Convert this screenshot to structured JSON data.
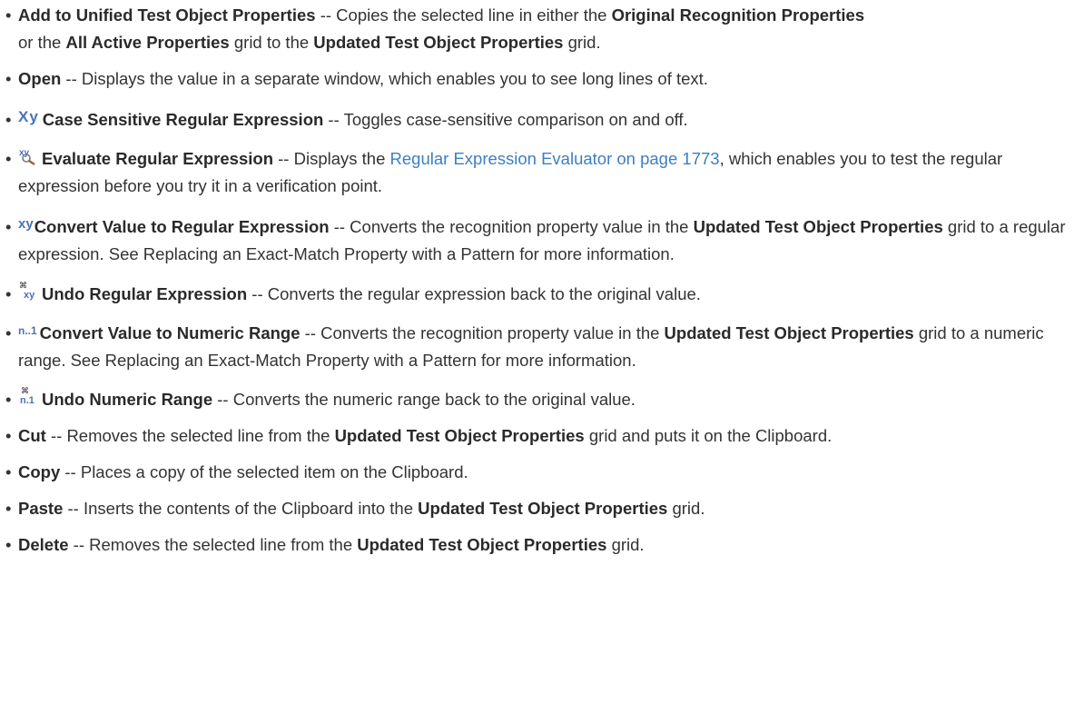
{
  "items": [
    {
      "title": "Add to Unified Test Object Properties",
      "sep": " -- ",
      "t1": "Copies the selected line in either the ",
      "b1": "Original Recognition Properties",
      "t2": " or the ",
      "b2": "All Active Properties",
      "t3": " grid to the ",
      "b3": "Updated Test Object Properties",
      "t4": " grid."
    },
    {
      "title": "Open",
      "sep": " -- ",
      "t1": "Displays the value in a separate window, which enables you to see long lines of text."
    },
    {
      "icon": "case-sensitive-regex-icon",
      "title": "Case Sensitive Regular Expression",
      "sep": " -- ",
      "t1": "Toggles case-sensitive comparison on and off."
    },
    {
      "icon": "evaluate-regex-icon",
      "title": "Evaluate Regular Expression",
      "sep": " -- ",
      "t1": "Displays the ",
      "link": "Regular Expression Evaluator on page 1773",
      "t2": ", which enables you to test the regular expression before you try it in a verification point."
    },
    {
      "icon": "convert-to-regex-icon",
      "title": "Convert Value to Regular Expression",
      "sep": " -- ",
      "t1": "Converts the recognition property value in the ",
      "b1": "Updated Test Object Properties",
      "t2": " grid to a regular expression. See Replacing an Exact-Match Property with a Pattern for more information."
    },
    {
      "icon": "undo-regex-icon",
      "title": "Undo Regular Expression",
      "sep": " -- ",
      "t1": "Converts the regular expression back to the original value."
    },
    {
      "icon": "numeric-range-icon",
      "title": "Convert Value to Numeric Range",
      "sep": " -- ",
      "t1": "Converts the recognition property value in the ",
      "b1": "Updated Test Object Properties",
      "t2": " grid to a numeric range. See Replacing an Exact-Match Property with a Pattern for more information."
    },
    {
      "icon": "undo-numeric-range-icon",
      "title": "Undo Numeric Range",
      "sep": " -- ",
      "t1": "Converts the numeric range back to the original value."
    },
    {
      "title": "Cut",
      "sep": " -- ",
      "t1": "Removes the selected line from the ",
      "b1": "Updated Test Object Properties",
      "t2": " grid and puts it on the Clipboard."
    },
    {
      "title": "Copy",
      "sep": " -- ",
      "t1": "Places a copy of the selected item on the Clipboard."
    },
    {
      "title": "Paste",
      "sep": " -- ",
      "t1": "Inserts the contents of the Clipboard into the ",
      "b1": "Updated Test Object Properties",
      "t2": " grid."
    },
    {
      "title": "Delete",
      "sep": " -- ",
      "t1": "Removes the selected line from the ",
      "b1": "Updated Test Object Properties",
      "t2": " grid."
    }
  ],
  "icon_glyphs": {
    "case_sensitive": "Xy",
    "convert_regex": "xy",
    "numeric_range": "n..1",
    "undo_numeric": "n.1"
  },
  "colors": {
    "text": "#333333",
    "link": "#3b7fc4",
    "icon": "#4a73b8"
  }
}
